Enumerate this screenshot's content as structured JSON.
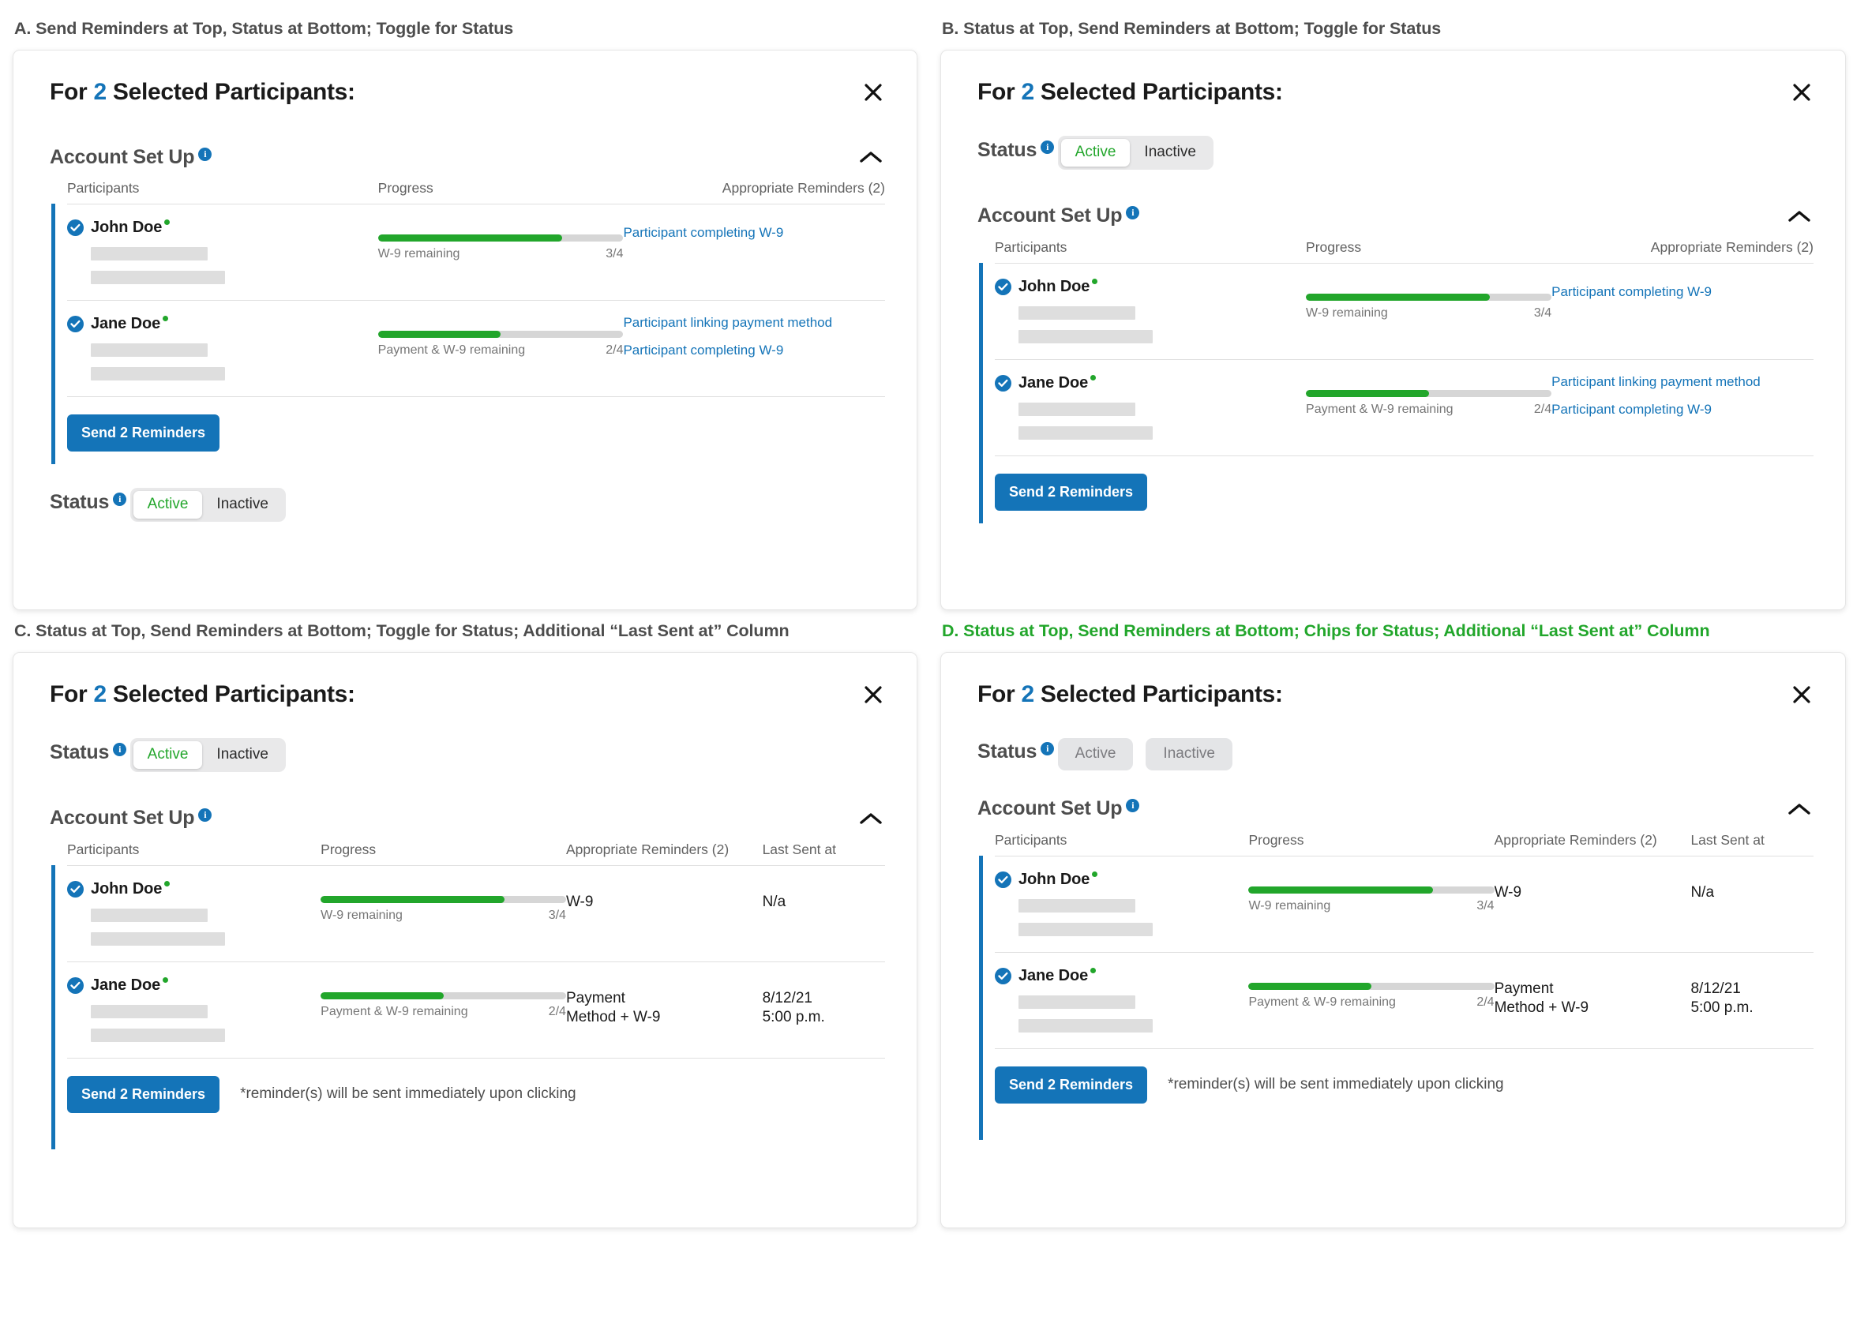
{
  "panels": {
    "a": {
      "heading": "A. Send Reminders at Top, Status at Bottom; Toggle for Status",
      "title_prefix": "For ",
      "title_count": "2",
      "title_suffix": " Selected Participants:",
      "close_icon": "close-icon",
      "section_label": "Account Set Up",
      "collapse_icon": "chevron-up-icon",
      "columns": [
        "Participants",
        "Progress",
        "Appropriate Reminders (2)"
      ],
      "send_label": "Send 2 Reminders",
      "status_label": "Status",
      "status_options": [
        "Active",
        "Inactive"
      ],
      "status_selected": "Active"
    },
    "b": {
      "heading": "B. Status at Top, Send Reminders at Bottom; Toggle for Status",
      "title_prefix": "For ",
      "title_count": "2",
      "title_suffix": " Selected Participants:",
      "close_icon": "close-icon",
      "status_label": "Status",
      "status_options": [
        "Active",
        "Inactive"
      ],
      "status_selected": "Active",
      "section_label": "Account Set Up",
      "collapse_icon": "chevron-up-icon",
      "columns": [
        "Participants",
        "Progress",
        "Appropriate Reminders (2)"
      ],
      "send_label": "Send 2 Reminders"
    },
    "c": {
      "heading": "C. Status at Top, Send Reminders at Bottom; Toggle for Status; Additional “Last Sent at” Column",
      "title_prefix": "For ",
      "title_count": "2",
      "title_suffix": " Selected Participants:",
      "close_icon": "close-icon",
      "status_label": "Status",
      "status_options": [
        "Active",
        "Inactive"
      ],
      "status_selected": "Active",
      "section_label": "Account Set Up",
      "collapse_icon": "chevron-up-icon",
      "columns": [
        "Participants",
        "Progress",
        "Appropriate Reminders (2)",
        "Last Sent at"
      ],
      "send_label": "Send 2 Reminders",
      "note": "*reminder(s) will be sent immediately upon clicking"
    },
    "d": {
      "heading": "D. Status at Top, Send Reminders at Bottom; Chips for Status; Additional “Last Sent at” Column",
      "heading_color": "#22a62b",
      "title_prefix": "For ",
      "title_count": "2",
      "title_suffix": " Selected Participants:",
      "close_icon": "close-icon",
      "status_label": "Status",
      "status_options": [
        "Active",
        "Inactive"
      ],
      "status_style": "chips",
      "section_label": "Account Set Up",
      "collapse_icon": "chevron-up-icon",
      "columns": [
        "Participants",
        "Progress",
        "Appropriate Reminders (2)",
        "Last Sent at"
      ],
      "send_label": "Send 2 Reminders",
      "note": "*reminder(s) will be sent immediately upon clicking"
    }
  },
  "participants": [
    {
      "name": "John Doe",
      "online": true,
      "checked": true,
      "progress_percent": 75,
      "progress_label": "W-9 remaining",
      "progress_count": "3/4",
      "reminders_links": [
        "Participant completing W-9"
      ],
      "reminders_text": "W-9",
      "last_sent": "N/a",
      "last_sent_line1": "N/a",
      "last_sent_line2": ""
    },
    {
      "name": "Jane Doe",
      "online": true,
      "checked": true,
      "progress_percent": 50,
      "progress_label": "Payment & W-9 remaining",
      "progress_count": "2/4",
      "reminders_links": [
        "Participant linking payment method",
        "Participant completing W-9"
      ],
      "reminders_text": "Payment Method + W-9",
      "last_sent": "8/12/21 5:00 p.m.",
      "last_sent_line1": "8/12/21",
      "last_sent_line2": "5:00 p.m."
    }
  ],
  "colors": {
    "accent_blue": "#1474b8",
    "green": "#22a62b",
    "track_grey": "#d6d6d6",
    "skeleton_grey": "#dedede",
    "chip_grey": "#e4e5e7"
  }
}
